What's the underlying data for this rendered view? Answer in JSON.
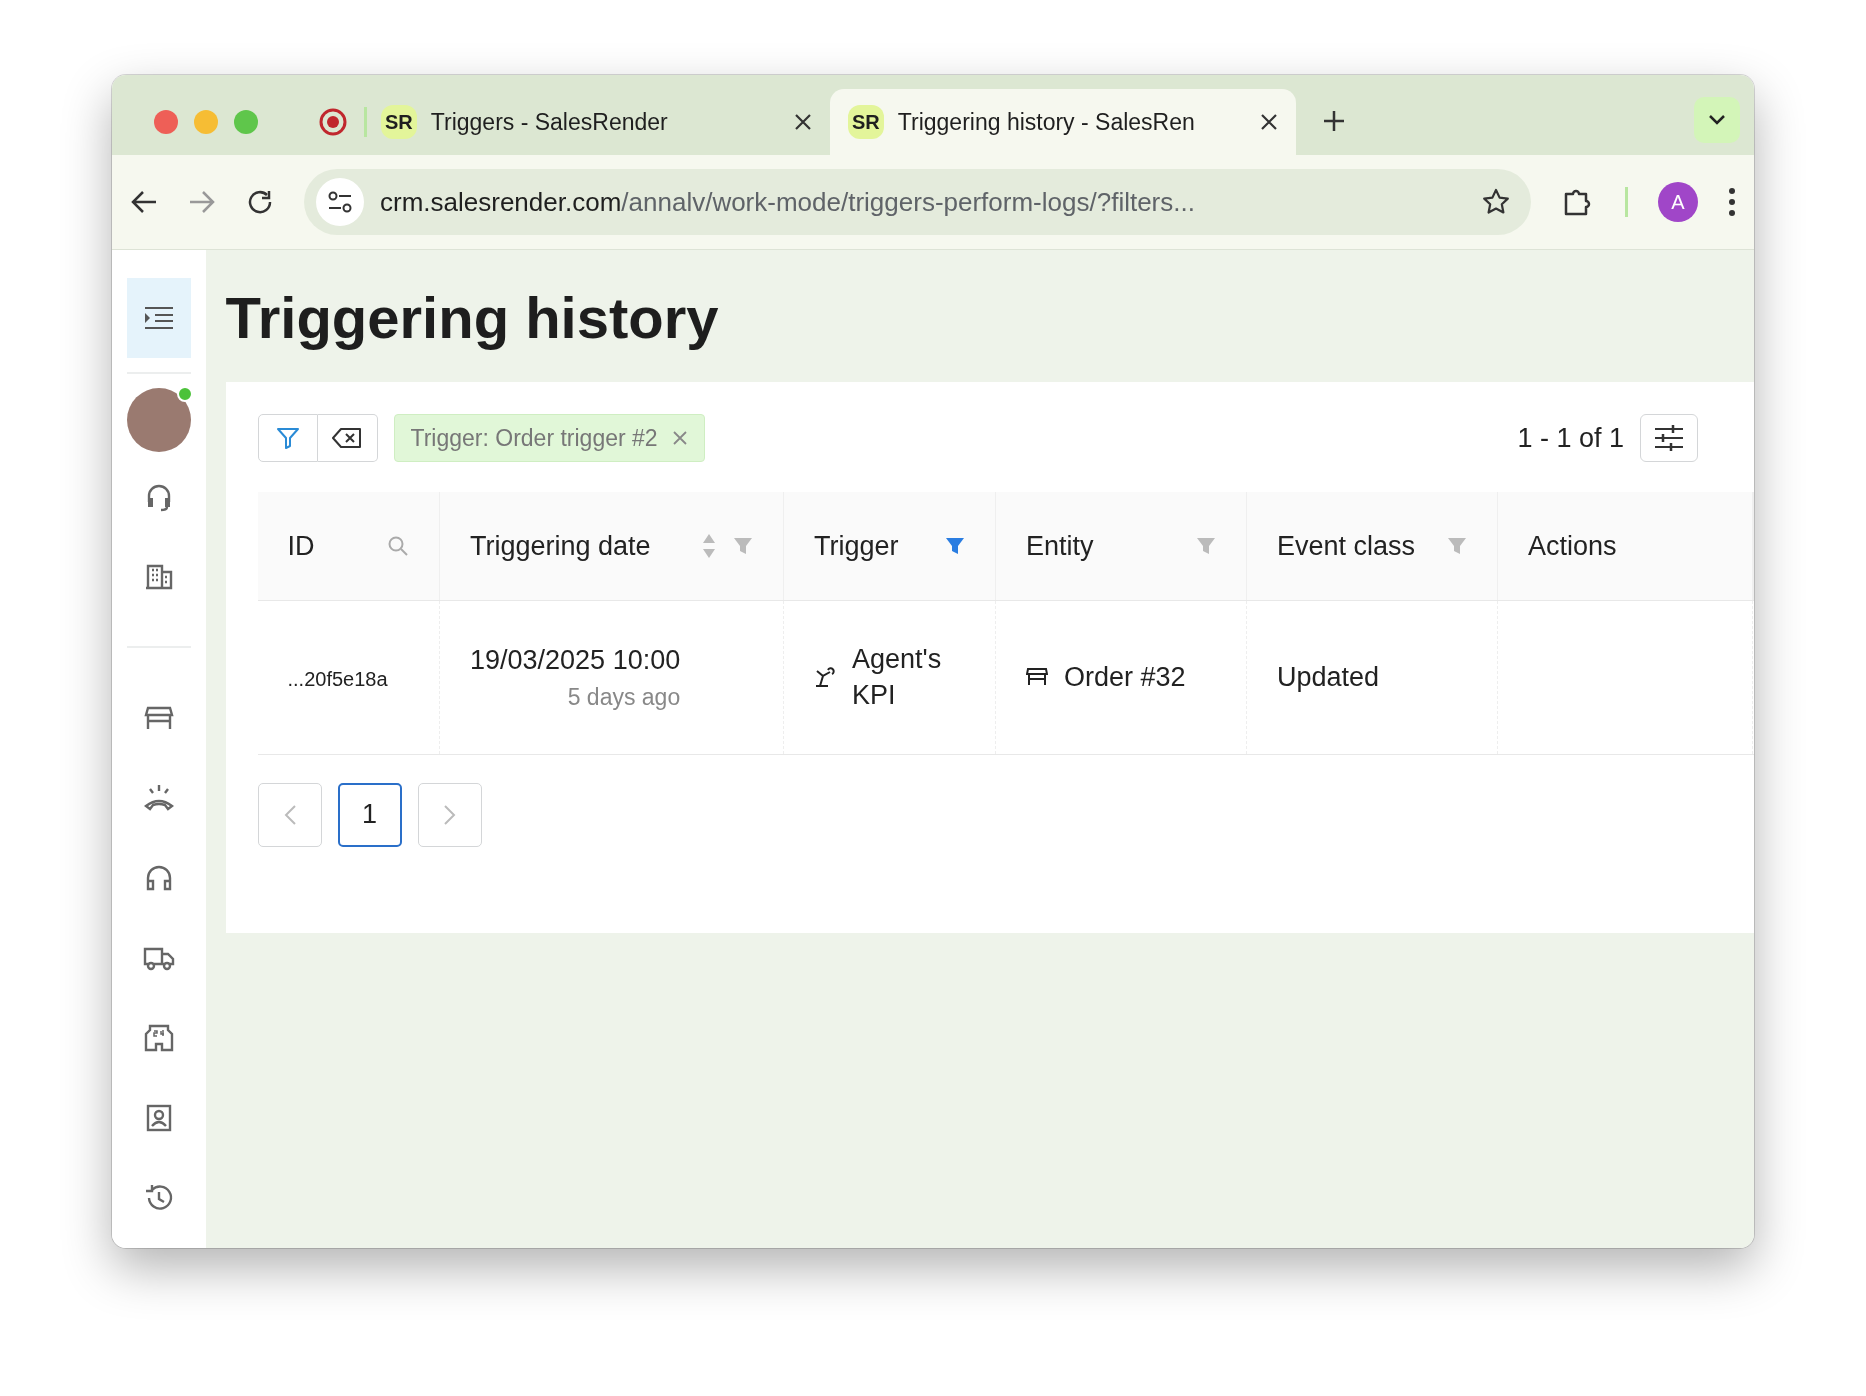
{
  "browser": {
    "tabs": [
      {
        "title": "Triggers - SalesRender",
        "favicon": "SR",
        "selected": false
      },
      {
        "title": "Triggering history - SalesRen",
        "favicon": "SR",
        "selected": true
      }
    ],
    "address": {
      "host": "crm.salesrender.com",
      "path": "/annalv/work-mode/triggers-perform-logs/?filters..."
    },
    "profile": "A"
  },
  "sidebar": {
    "user": {
      "online": true
    }
  },
  "page": {
    "title": "Triggering history"
  },
  "toolbar": {
    "chips": [
      {
        "label": "Trigger: Order trigger #2"
      }
    ],
    "range": "1 - 1 of 1"
  },
  "table": {
    "columns": [
      {
        "label": "ID",
        "kind": "search"
      },
      {
        "label": "Triggering date",
        "kind": "sort-filter",
        "filter_active": false
      },
      {
        "label": "Trigger",
        "kind": "filter",
        "filter_active": true
      },
      {
        "label": "Entity",
        "kind": "filter",
        "filter_active": false
      },
      {
        "label": "Event class",
        "kind": "filter",
        "filter_active": false
      },
      {
        "label": "Actions",
        "kind": "plain"
      }
    ],
    "rows": [
      {
        "id": "...20f5e18a",
        "date": "19/03/2025 10:00",
        "ago": "5 days ago",
        "trigger": "Agent's KPI",
        "entity": "Order #32",
        "event_class": "Updated"
      }
    ]
  },
  "pagination": {
    "pages": [
      {
        "label": "1",
        "selected": true
      }
    ]
  }
}
